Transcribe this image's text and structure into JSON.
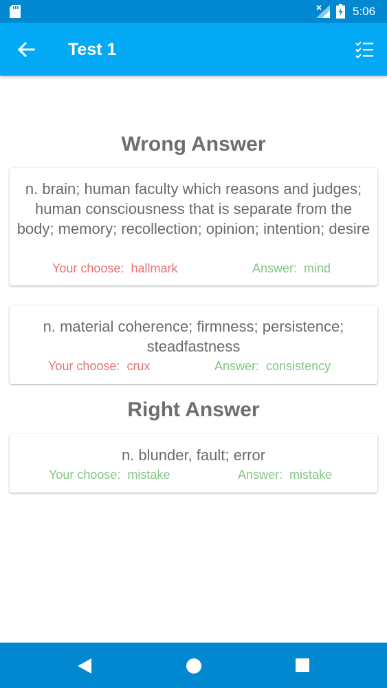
{
  "status_bar": {
    "time": "5:06"
  },
  "app_bar": {
    "title": "Test 1"
  },
  "sections": {
    "wrong_title": "Wrong Answer",
    "right_title": "Right Answer"
  },
  "labels": {
    "your_choose": "Your choose:",
    "answer": "Answer:"
  },
  "wrong_answers": [
    {
      "definition": "n. brain; human faculty which reasons and judges; human consciousness that is separate from the body; memory; recollection; opinion; intention; desire",
      "chosen": "hallmark",
      "answer": "mind"
    },
    {
      "definition": "n. material coherence; firmness; persistence; steadfastness",
      "chosen": "crux",
      "answer": "consistency"
    }
  ],
  "right_answers": [
    {
      "definition": "n. blunder, fault; error",
      "chosen": "mistake",
      "answer": "mistake"
    }
  ],
  "colors": {
    "status_bar": "#0288d1",
    "app_bar": "#03a9f4",
    "wrong": "#e57373",
    "right": "#81c784",
    "title_gray": "#6e6e6e"
  },
  "icons": {
    "sd": "sd-card-icon",
    "signal": "signal-no-data-icon",
    "battery": "battery-charging-icon",
    "back": "arrow-back-icon",
    "checklist": "checklist-icon",
    "nav_back": "triangle-back-icon",
    "nav_home": "circle-home-icon",
    "nav_recent": "square-recent-icon"
  }
}
